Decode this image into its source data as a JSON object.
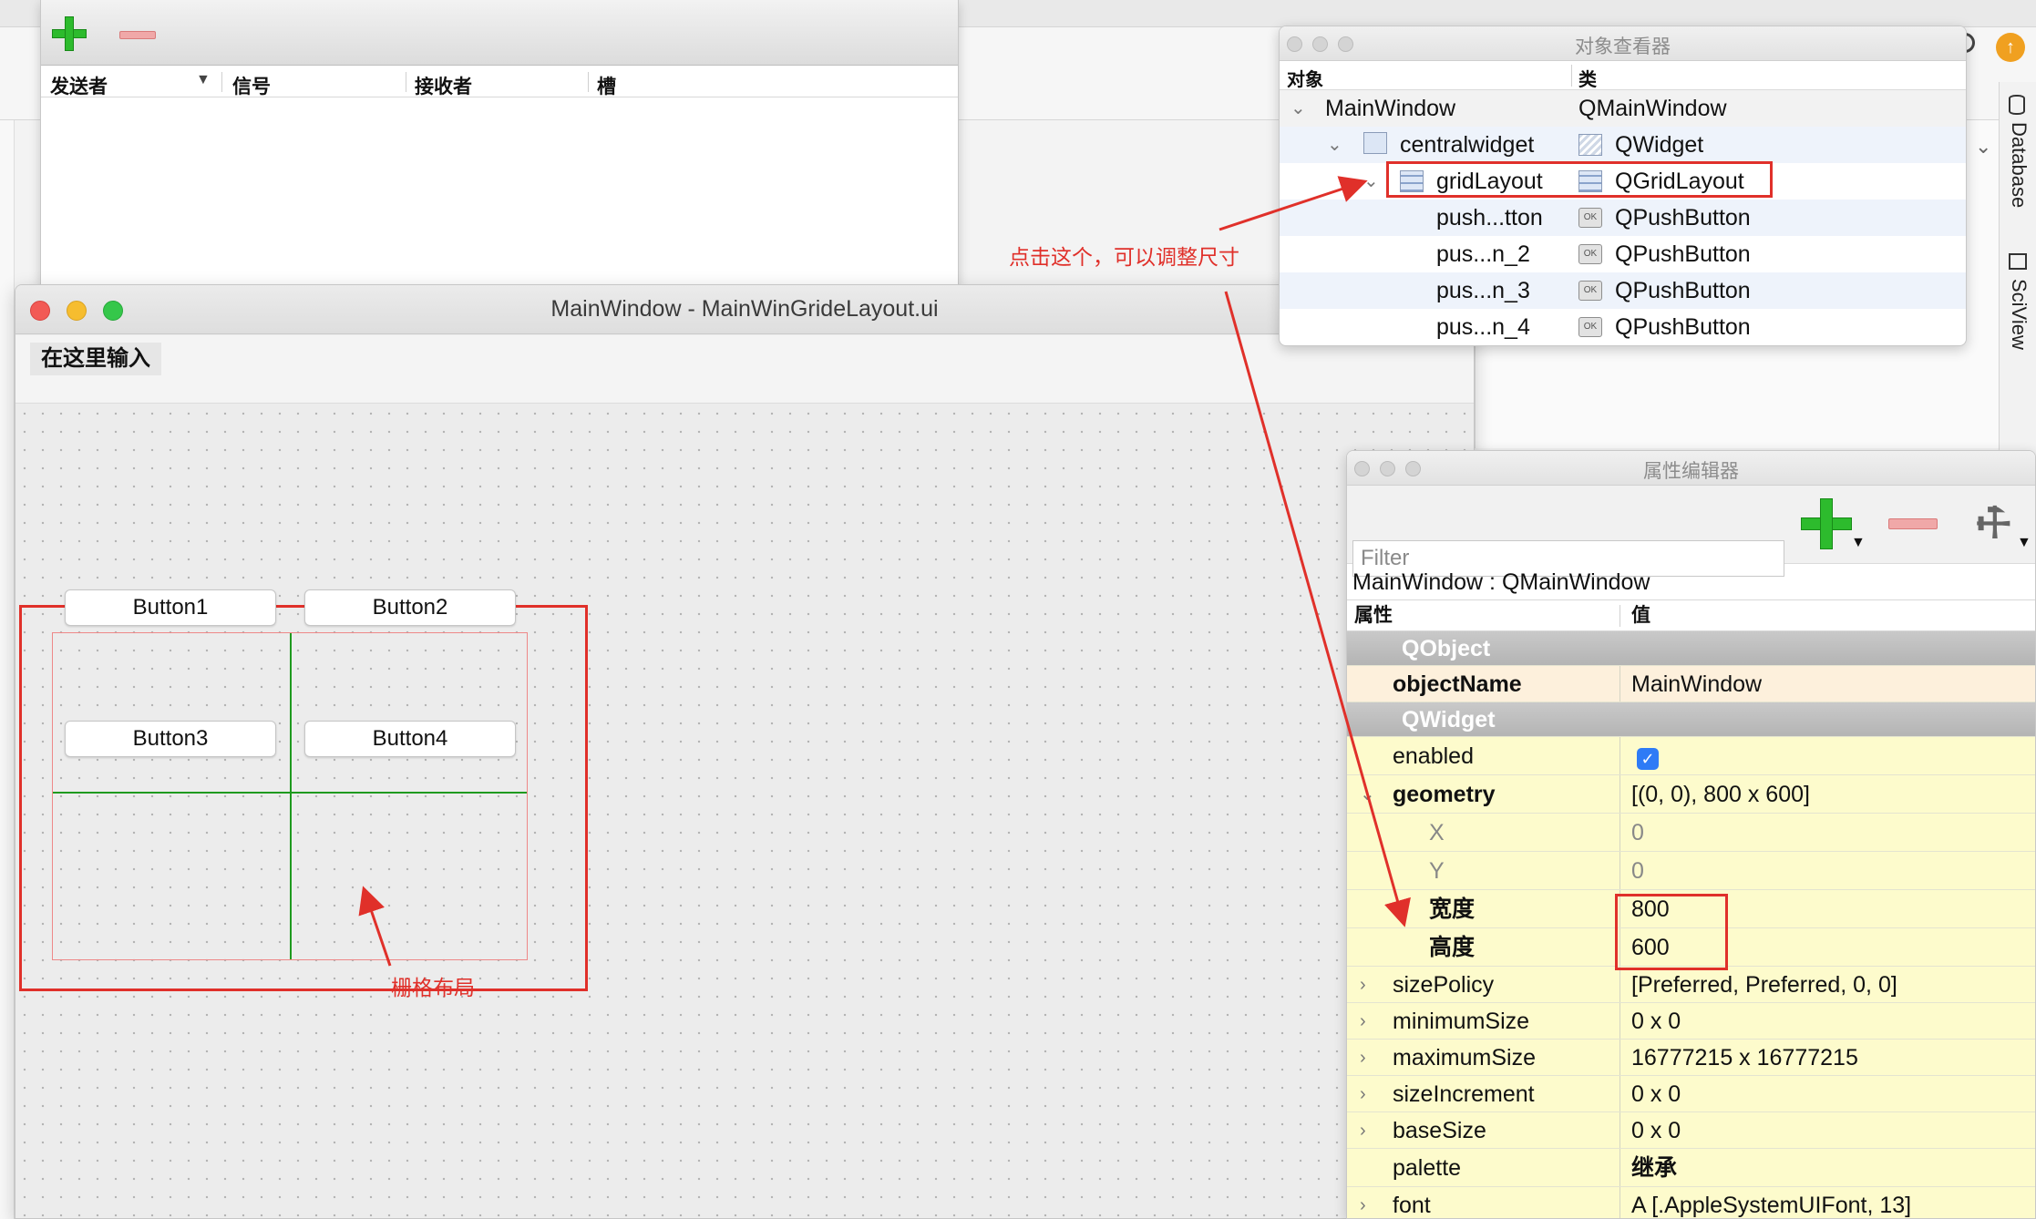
{
  "signal_editor": {
    "columns": [
      "发送者",
      "信号",
      "接收者",
      "槽"
    ]
  },
  "main_window": {
    "title": "MainWindow - MainWinGrideLayout.ui",
    "menu_placeholder": "在这里输入",
    "buttons": [
      "Button1",
      "Button2",
      "Button3",
      "Button4"
    ]
  },
  "object_inspector": {
    "title": "对象查看器",
    "col_object": "对象",
    "col_class": "类",
    "rows": [
      {
        "name": "MainWindow",
        "cls": "QMainWindow"
      },
      {
        "name": "centralwidget",
        "cls": "QWidget"
      },
      {
        "name": "gridLayout",
        "cls": "QGridLayout"
      },
      {
        "name": "push...tton",
        "cls": "QPushButton"
      },
      {
        "name": "pus...n_2",
        "cls": "QPushButton"
      },
      {
        "name": "pus...n_3",
        "cls": "QPushButton"
      },
      {
        "name": "pus...n_4",
        "cls": "QPushButton"
      }
    ]
  },
  "property_editor": {
    "title": "属性编辑器",
    "filter_placeholder": "Filter",
    "class_line": "MainWindow : QMainWindow",
    "col_property": "属性",
    "col_value": "值",
    "rows": [
      {
        "name": "QObject",
        "value": ""
      },
      {
        "name": "objectName",
        "value": "MainWindow"
      },
      {
        "name": "QWidget",
        "value": ""
      },
      {
        "name": "enabled",
        "value": "✓"
      },
      {
        "name": "geometry",
        "value": "[(0, 0), 800 x 600]"
      },
      {
        "name": "X",
        "value": "0"
      },
      {
        "name": "Y",
        "value": "0"
      },
      {
        "name": "宽度",
        "value": "800"
      },
      {
        "name": "高度",
        "value": "600"
      },
      {
        "name": "sizePolicy",
        "value": "[Preferred, Preferred, 0, 0]"
      },
      {
        "name": "minimumSize",
        "value": "0 x 0"
      },
      {
        "name": "maximumSize",
        "value": "16777215 x 16777215"
      },
      {
        "name": "sizeIncrement",
        "value": "0 x 0"
      },
      {
        "name": "baseSize",
        "value": "0 x 0"
      },
      {
        "name": "palette",
        "value": "继承"
      },
      {
        "name": "font",
        "value": "A  [.AppleSystemUIFont, 13]"
      }
    ]
  },
  "ide_side_tabs": [
    "Database",
    "SciView"
  ],
  "annotations": {
    "click_here": "点击这个，可以调整尺寸",
    "grid_layout": "栅格布局"
  },
  "colors": {
    "annotation_red": "#e0302a",
    "grid_green": "#1f9a1f",
    "property_yellow": "#fdfbcc"
  }
}
